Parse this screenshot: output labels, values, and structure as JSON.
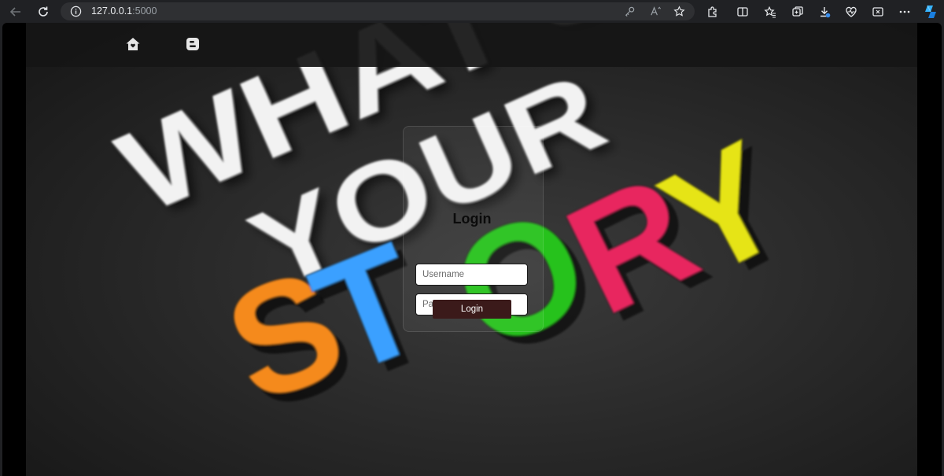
{
  "browser": {
    "url_host": "127.0.0.1",
    "url_port": ":5000",
    "icons": [
      "back-icon",
      "refresh-icon",
      "info-icon",
      "key-icon",
      "read-aloud-icon",
      "favorite-star-icon",
      "extensions-icon",
      "split-screen-icon",
      "favorites-icon",
      "collections-icon",
      "downloads-icon",
      "browser-essentials-icon",
      "screenshot-icon",
      "settings-more-icon",
      "copilot-icon"
    ]
  },
  "backdrop": {
    "line1": "WHAT'S",
    "line2": "YOUR",
    "letters": [
      "S",
      "T",
      "O",
      "R",
      "Y"
    ],
    "letter_colors": [
      "#f58a1f",
      "#3aa0ff",
      "#28c21c",
      "#e8285f",
      "#e6e412"
    ]
  },
  "navbar": {
    "icons": [
      "home-icon",
      "blogger-icon"
    ]
  },
  "login": {
    "title": "Login",
    "username_placeholder": "Username",
    "password_placeholder": "Password",
    "button_label": "Login"
  }
}
